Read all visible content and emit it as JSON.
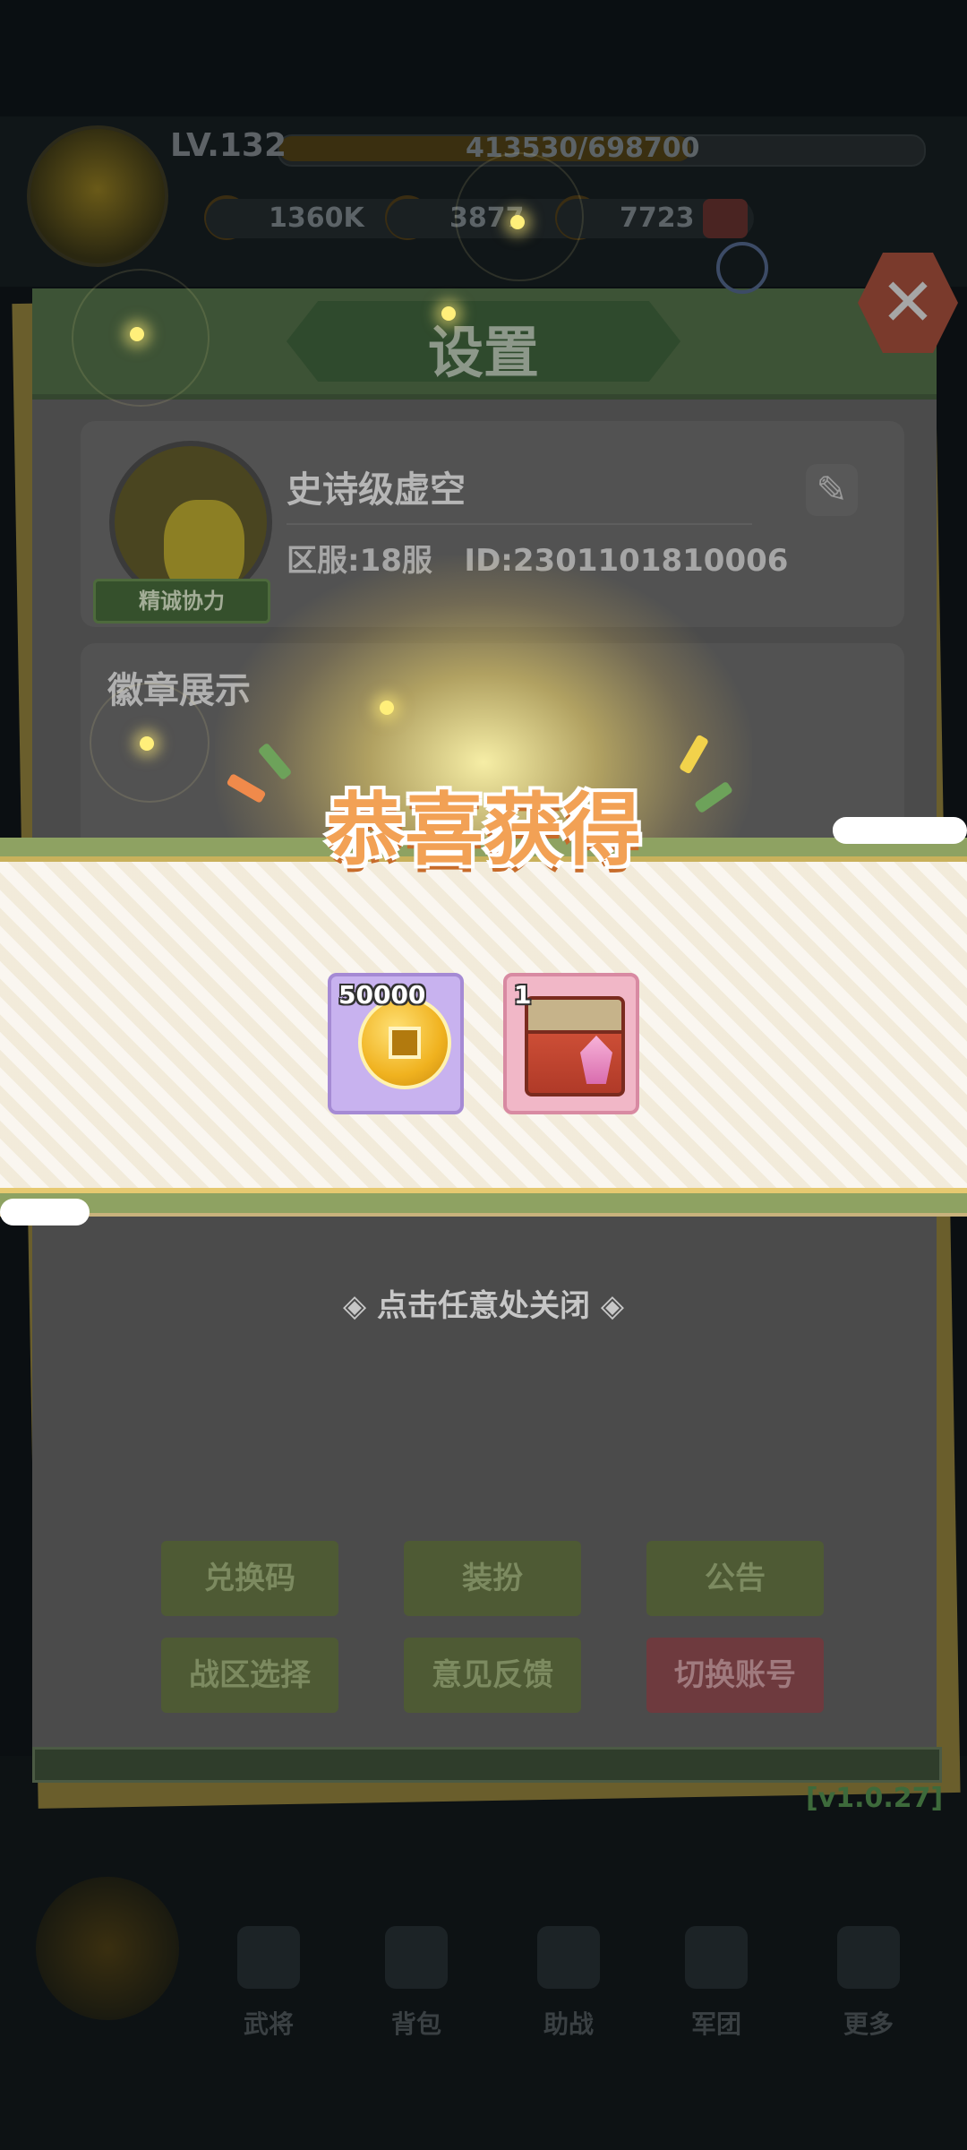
{
  "hud": {
    "level": "LV.132",
    "xp_text": "413530/698700",
    "resources": [
      {
        "icon": "power-icon",
        "value": "1360K"
      },
      {
        "icon": "coin-icon",
        "value": "3877"
      },
      {
        "icon": "gem-icon",
        "value": "7723"
      }
    ]
  },
  "settings": {
    "title": "设置",
    "profile": {
      "name": "史诗级虚空",
      "badge": "精诚协力",
      "server_id": "区服:18服   ID:2301101810006"
    },
    "badge_section_title": "徽章展示",
    "buttons": [
      {
        "label": "兑换码"
      },
      {
        "label": "装扮"
      },
      {
        "label": "公告"
      },
      {
        "label": "战区选择"
      },
      {
        "label": "意见反馈"
      },
      {
        "label": "切换账号"
      }
    ],
    "version": "[v1.0.27]"
  },
  "reward_popup": {
    "title": "恭喜获得",
    "items": [
      {
        "icon": "copper-coin-icon",
        "count": "50000",
        "bg_color": "#c8b2ef"
      },
      {
        "icon": "treasure-chest-icon",
        "count": "1",
        "bg_color": "#f1b7c7"
      }
    ],
    "close_hint": "点击任意处关闭"
  },
  "bottom_nav": [
    {
      "label": "武将"
    },
    {
      "label": "背包"
    },
    {
      "label": "助战"
    },
    {
      "label": "军团"
    },
    {
      "label": "更多"
    }
  ],
  "colors": {
    "banner_stripe": "#8ea262",
    "title_orange": "#f2a155",
    "coin_card": "#c8b2ef",
    "chest_card": "#f1b7c7"
  }
}
